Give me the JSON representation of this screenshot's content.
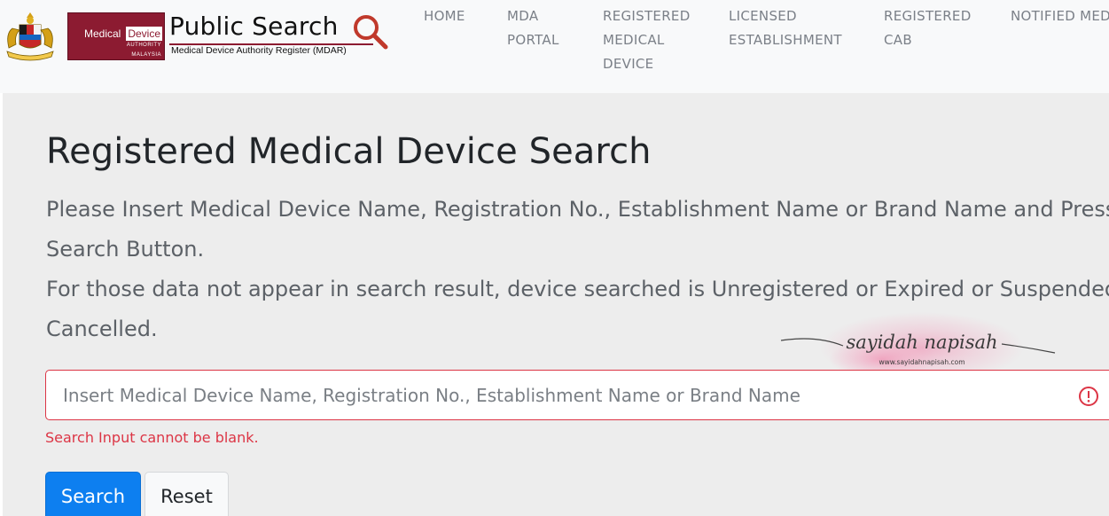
{
  "header": {
    "logo": {
      "medical": "Medical",
      "device": "Device",
      "authority": "AUTHORITY",
      "malaysia": "MALAYSIA"
    },
    "brand_title": "Public Search",
    "brand_subtitle": "Medical Device Authority Register (MDAR)",
    "nav": [
      {
        "label": "HOME"
      },
      {
        "label": "MDA PORTAL"
      },
      {
        "label": "REGISTERED MEDICAL DEVICE"
      },
      {
        "label": "LICENSED ESTABLISHMENT"
      },
      {
        "label": "REGISTERED CAB"
      },
      {
        "label": "NOTIFIED MEDI"
      }
    ]
  },
  "main": {
    "title": "Registered Medical Device Search",
    "instruction_1": "Please Insert Medical Device Name, Registration No., Establishment Name or Brand Name and Press Search Button.",
    "instruction_2": "For those data not appear in search result, device searched is Unregistered or Expired or Suspended or Cancelled.",
    "search": {
      "value": "",
      "placeholder": "Insert Medical Device Name, Registration No., Establishment Name or Brand Name",
      "error": "Search Input cannot be blank."
    },
    "buttons": {
      "search": "Search",
      "reset": "Reset"
    }
  },
  "watermark": {
    "text": "sayidah napisah",
    "url": "www.sayidahnapisah.com"
  },
  "colors": {
    "brand": "#8c1b31",
    "primary": "#0d7ff0",
    "danger": "#dc3545",
    "panel": "#ededed"
  }
}
